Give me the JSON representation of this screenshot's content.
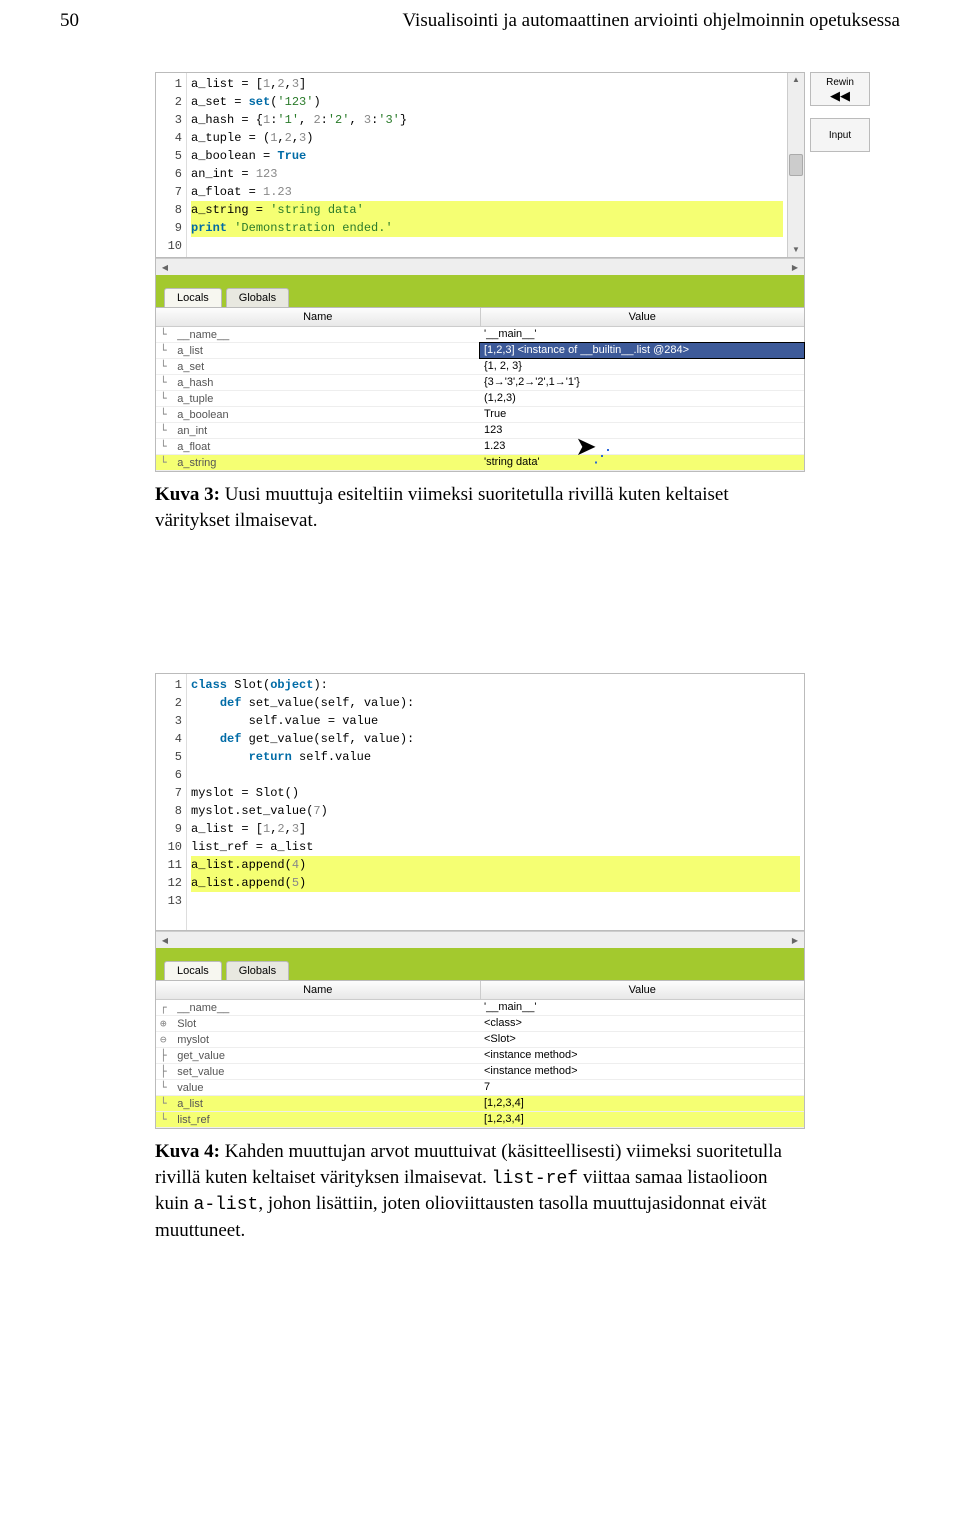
{
  "header": {
    "page_number": "50",
    "running_title": "Visualisointi ja automaattinen arviointi ohjelmoinnin opetuksessa"
  },
  "figure3": {
    "side_buttons": [
      {
        "label": "Rewin",
        "glyph": "◀◀"
      },
      {
        "label": "Input",
        "glyph": ""
      }
    ],
    "gutter": [
      "1",
      "2",
      "3",
      "4",
      "5",
      "6",
      "7",
      "8",
      "9",
      "10"
    ],
    "code_lines": [
      {
        "html": "a_list = [<span class='num'>1</span>,<span class='num'>2</span>,<span class='num'>3</span>]",
        "hl": false
      },
      {
        "html": "a_set = <span class='kw'>set</span>(<span class='str'>'123'</span>)",
        "hl": false
      },
      {
        "html": "a_hash = {<span class='num'>1</span>:<span class='str'>'1'</span>, <span class='num'>2</span>:<span class='str'>'2'</span>, <span class='num'>3</span>:<span class='str'>'3'</span>}",
        "hl": false
      },
      {
        "html": "a_tuple = (<span class='num'>1</span>,<span class='num'>2</span>,<span class='num'>3</span>)",
        "hl": false
      },
      {
        "html": "a_boolean = <span class='kw'>True</span>",
        "hl": false
      },
      {
        "html": "an_int = <span class='num'>123</span>",
        "hl": false
      },
      {
        "html": "a_float = <span class='num'>1.23</span>",
        "hl": false
      },
      {
        "html": "a_string = <span class='str'>'string data'</span>",
        "hl": true
      },
      {
        "html": "<span class='kw'>print</span> <span class='str'>'Demonstration ended.'</span>",
        "hl": true
      },
      {
        "html": "",
        "hl": false
      }
    ],
    "tabs": [
      "Locals",
      "Globals"
    ],
    "var_headers": [
      "Name",
      "Value"
    ],
    "vars": [
      {
        "name": "__name__",
        "value": "'__main__'",
        "glyph": "└ ",
        "hl": false,
        "sel": false
      },
      {
        "name": "a_list",
        "value": "[1,2,3] <instance of __builtin__.list @284>",
        "glyph": "└ ",
        "hl": false,
        "sel": true
      },
      {
        "name": "a_set",
        "value": "{1, 2, 3}",
        "glyph": "└ ",
        "hl": false,
        "sel": false
      },
      {
        "name": "a_hash",
        "value": "{3→'3',2→'2',1→'1'}",
        "glyph": "└ ",
        "hl": false,
        "sel": false
      },
      {
        "name": "a_tuple",
        "value": "(1,2,3)",
        "glyph": "└ ",
        "hl": false,
        "sel": false
      },
      {
        "name": "a_boolean",
        "value": "True",
        "glyph": "└ ",
        "hl": false,
        "sel": false
      },
      {
        "name": "an_int",
        "value": "123",
        "glyph": "└ ",
        "hl": false,
        "sel": false
      },
      {
        "name": "a_float",
        "value": "1.23",
        "glyph": "└ ",
        "hl": false,
        "sel": false
      },
      {
        "name": "a_string",
        "value": "'string data'",
        "glyph": "└ ",
        "hl": true,
        "sel": false
      }
    ],
    "caption_strong": "Kuva 3:",
    "caption_rest": " Uusi muuttuja esiteltiin viimeksi suoritetulla rivillä kuten keltaiset väritykset ilmaisevat."
  },
  "figure4": {
    "gutter": [
      "1",
      "2",
      "3",
      "4",
      "5",
      "6",
      "7",
      "8",
      "9",
      "10",
      "11",
      "12",
      "13",
      " "
    ],
    "code_lines": [
      {
        "html": "<span class='kw'>class</span> Slot(<span class='kw'>object</span>):",
        "hl": false
      },
      {
        "html": "    <span class='kw'>def</span> set_value(self, value):",
        "hl": false
      },
      {
        "html": "        self.value = value",
        "hl": false
      },
      {
        "html": "    <span class='kw'>def</span> get_value(self, value):",
        "hl": false
      },
      {
        "html": "        <span class='kw'>return</span> self.value",
        "hl": false
      },
      {
        "html": "",
        "hl": false
      },
      {
        "html": "myslot = Slot()",
        "hl": false
      },
      {
        "html": "myslot.set_value(<span class='num'>7</span>)",
        "hl": false
      },
      {
        "html": "a_list = [<span class='num'>1</span>,<span class='num'>2</span>,<span class='num'>3</span>]",
        "hl": false
      },
      {
        "html": "list_ref = a_list",
        "hl": false
      },
      {
        "html": "a_list.append(<span class='num'>4</span>)",
        "hl": true
      },
      {
        "html": "a_list.append(<span class='num'>5</span>)",
        "hl": true
      },
      {
        "html": "",
        "hl": false
      },
      {
        "html": "",
        "hl": false
      }
    ],
    "tabs": [
      "Locals",
      "Globals"
    ],
    "var_headers": [
      "Name",
      "Value"
    ],
    "vars": [
      {
        "name": "__name__",
        "value": "'__main__'",
        "glyph": "┌ ",
        "hl": false
      },
      {
        "name": "Slot",
        "value": "<class>",
        "glyph": "⊕ ",
        "hl": false
      },
      {
        "name": "myslot",
        "value": "<Slot>",
        "glyph": "⊖ ",
        "hl": false
      },
      {
        "name": "get_value",
        "value": "<instance method>",
        "glyph": "  ├ ",
        "hl": false
      },
      {
        "name": "set_value",
        "value": "<instance method>",
        "glyph": "  ├ ",
        "hl": false
      },
      {
        "name": "value",
        "value": "7",
        "glyph": "  └ ",
        "hl": false
      },
      {
        "name": "a_list",
        "value": "[1,2,3,4]",
        "glyph": "└ ",
        "hl": true
      },
      {
        "name": "list_ref",
        "value": "[1,2,3,4]",
        "glyph": "└ ",
        "hl": true
      }
    ],
    "caption_strong": "Kuva 4:",
    "caption_rest_1": " Kahden muuttujan arvot muuttuivat (käsitteellisesti) viimeksi suoritetulla rivillä kuten keltaiset värityksen ilmaisevat. ",
    "caption_mono_1": "list-ref",
    "caption_rest_2": " viittaa samaa listaolioon kuin ",
    "caption_mono_2": "a-list",
    "caption_rest_3": ", johon lisättiin, joten olioviittausten tasolla muuttujasidonnat eivät muuttuneet."
  }
}
